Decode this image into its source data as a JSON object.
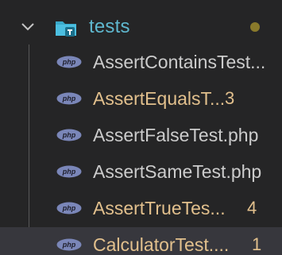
{
  "folder": {
    "name": "tests",
    "expanded": true,
    "icon": "folder-test-icon",
    "indicator_color": "#8a7a2b"
  },
  "files": [
    {
      "name": "AssertContainsTest...",
      "badge": "",
      "modified": false,
      "icon": "php-icon"
    },
    {
      "name": "AssertEqualsT...",
      "badge": "3",
      "modified": true,
      "icon": "php-icon"
    },
    {
      "name": "AssertFalseTest.php",
      "badge": "",
      "modified": false,
      "icon": "php-icon"
    },
    {
      "name": "AssertSameTest.php",
      "badge": "",
      "modified": false,
      "icon": "php-icon"
    },
    {
      "name": "AssertTrueTes...",
      "badge": "4",
      "modified": true,
      "icon": "php-icon"
    },
    {
      "name": "CalculatorTest....",
      "badge": "1",
      "modified": true,
      "selected": true,
      "icon": "php-icon"
    }
  ],
  "colors": {
    "background": "#252526",
    "selected_row": "#37373d",
    "default_text": "#cccccc",
    "modified_text": "#e2c08d",
    "folder_text": "#5fb8cf",
    "php_badge": "#7a86b8"
  }
}
